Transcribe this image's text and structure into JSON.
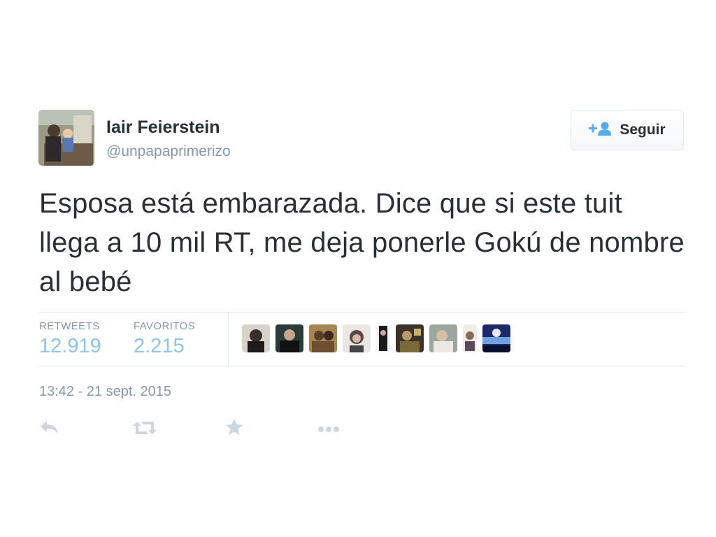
{
  "tweet": {
    "author_name": "Iair Feierstein",
    "author_handle": "@unpapaprimerizo",
    "follow_label": "Seguir",
    "text": "Esposa está embarazada. Dice que si este tuit llega a 10 mil RT, me deja ponerle Gokú de nombre al bebé",
    "timestamp": "13:42 - 21 sept. 2015"
  },
  "stats": {
    "retweets_label": "RETWEETS",
    "retweets_value": "12.919",
    "favorites_label": "FAVORITOS",
    "favorites_value": "2.215"
  },
  "icons": {
    "follow": "add-user-icon",
    "reply": "reply-icon",
    "retweet": "retweet-icon",
    "favorite": "star-icon",
    "more": "more-icon"
  },
  "colors": {
    "text": "#292f33",
    "muted": "#8899a6",
    "stat_value": "#8ec3eb",
    "follow_icon": "#55acee",
    "action_icon": "#ccd6dd",
    "divider": "#e1e8ed"
  }
}
